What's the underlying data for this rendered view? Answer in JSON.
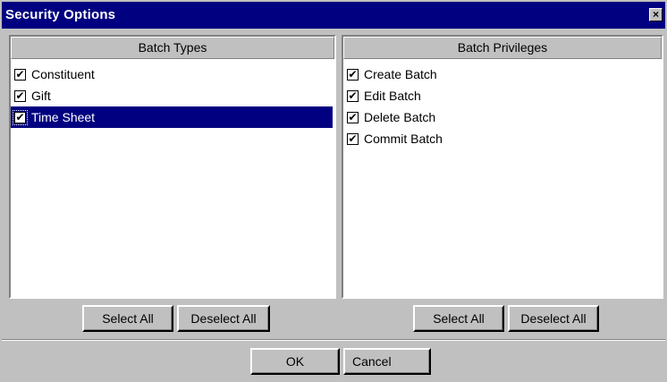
{
  "window": {
    "title": "Security Options",
    "close_label": "×"
  },
  "batch_types": {
    "header": "Batch Types",
    "items": [
      {
        "label": "Constituent",
        "checked": true,
        "selected": false
      },
      {
        "label": "Gift",
        "checked": true,
        "selected": false
      },
      {
        "label": "Time Sheet",
        "checked": true,
        "selected": true
      }
    ],
    "select_all": "Select All",
    "deselect_all": "Deselect All"
  },
  "batch_privileges": {
    "header": "Batch Privileges",
    "items": [
      {
        "label": "Create Batch",
        "checked": true
      },
      {
        "label": "Edit Batch",
        "checked": true
      },
      {
        "label": "Delete Batch",
        "checked": true
      },
      {
        "label": "Commit Batch",
        "checked": true
      }
    ],
    "select_all": "Select All",
    "deselect_all": "Deselect All"
  },
  "footer": {
    "ok": "OK",
    "cancel": "Cancel"
  },
  "colors": {
    "titlebar": "#000080",
    "face": "#c0c0c0",
    "selection": "#000080"
  },
  "icons": {
    "checkmark": "check-icon",
    "close": "close-icon"
  }
}
